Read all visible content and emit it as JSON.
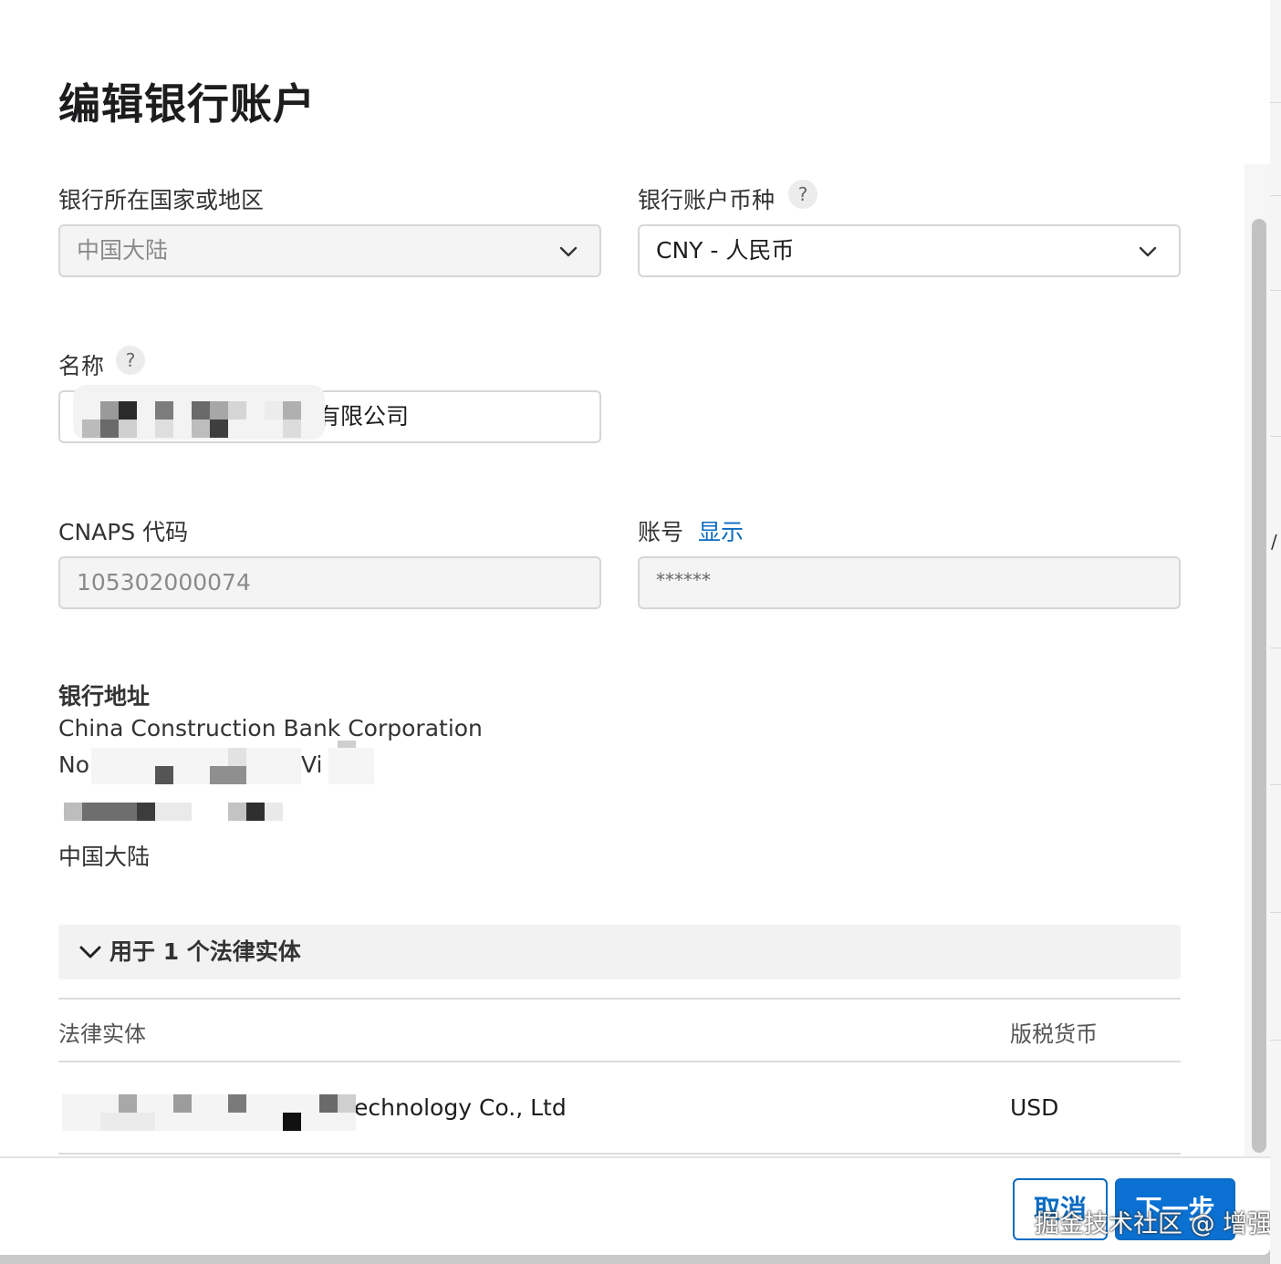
{
  "dialog": {
    "title": "编辑银行账户"
  },
  "bank_country": {
    "label": "银行所在国家或地区",
    "value": "中国大陆"
  },
  "currency": {
    "label": "银行账户币种",
    "help": "?",
    "value": "CNY - 人民币"
  },
  "name": {
    "label": "名称",
    "help": "?",
    "value_visible_suffix": "有限公司"
  },
  "cnaps": {
    "label": "CNAPS 代码",
    "value": "105302000074"
  },
  "account": {
    "label": "账号",
    "reveal_link": "显示",
    "masked_value": "******"
  },
  "bank_address": {
    "title": "银行地址",
    "line1": "China Construction Bank Corporation",
    "line2_fragment_a": "No",
    "line2_fragment_b": "Vi",
    "country": "中国大陆"
  },
  "legal_entities": {
    "toggle_label": "用于 1 个法律实体",
    "columns": [
      "法律实体",
      "版税货币"
    ],
    "rows": [
      {
        "entity_visible_suffix": "echnology Co., Ltd",
        "currency": "USD"
      }
    ]
  },
  "footer": {
    "cancel_label": "取消",
    "next_label": "下一步",
    "watermark": "掘金技术社区 @ 增强"
  },
  "colors": {
    "link": "#0a6bc2",
    "primary": "#0a71d3"
  },
  "icons": [
    "chevron-down-icon",
    "help-icon"
  ]
}
